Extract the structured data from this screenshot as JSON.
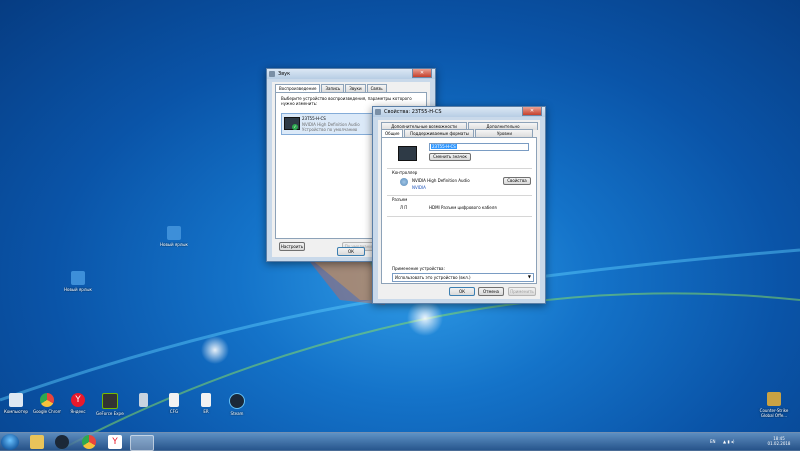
{
  "desktop": {
    "icons_bottom": [
      {
        "label": "Компьютер",
        "color": "#dfe8f2"
      },
      {
        "label": "Google Chrome",
        "color": "#e8453c"
      },
      {
        "label": "Яндекс",
        "color": "#e8192c"
      },
      {
        "label": "GeForce Experience",
        "color": "#333333"
      },
      {
        "label": "",
        "color": "#c8d3df"
      },
      {
        "label": "CFG",
        "color": "#f2f2f2"
      },
      {
        "label": "ER",
        "color": "#f2f2f2"
      },
      {
        "label": "Steam",
        "color": "#1b2838"
      }
    ],
    "icons_mid": [
      {
        "label": "Новый ярлык",
        "color": "#3d8fd9"
      },
      {
        "label": "Новый ярлык",
        "color": "#3d8fd9"
      }
    ],
    "icon_right": {
      "label": "Counter-Strike Global Offe...",
      "color": "#c9a243"
    }
  },
  "sound_dialog": {
    "title": "Звук",
    "tabs": [
      "Воспроизведение",
      "Запись",
      "Звуки",
      "Связь"
    ],
    "instruction": "Выберите устройство воспроизведения, параметры которого нужно изменить:",
    "device": {
      "name": "23T55-H-CS",
      "driver": "NVIDIA High Definition Audio",
      "status": "Устройство по умолчанию"
    },
    "configure_label": "Настроить",
    "default_label": "По умолчанию",
    "ok_label": "ОК"
  },
  "props_dialog": {
    "title": "Свойства: 23T55-H-CS",
    "tabs_top": [
      "Дополнительные возможности",
      "Дополнительно"
    ],
    "tabs_bottom": [
      "Общие",
      "Поддерживаемые форматы",
      "Уровни"
    ],
    "device_name": "23T55-H-CS",
    "change_icon_label": "Сменить значок",
    "controller_label": "Контроллер",
    "controller_name": "NVIDIA High Definition Audio",
    "controller_vendor": "NVIDIA",
    "properties_label": "Свойства",
    "connectors_label": "Разъем",
    "connector_side": "Л П",
    "connector_desc": "HDMI Разъем цифрового кабеля",
    "usage_label": "Применение устройства:",
    "usage_value": "Использовать это устройство (вкл.)",
    "ok_label": "ОК",
    "cancel_label": "Отмена",
    "apply_label": "Применить"
  },
  "tray": {
    "lang": "EN",
    "time": "18:45",
    "date": "01.02.2018"
  }
}
